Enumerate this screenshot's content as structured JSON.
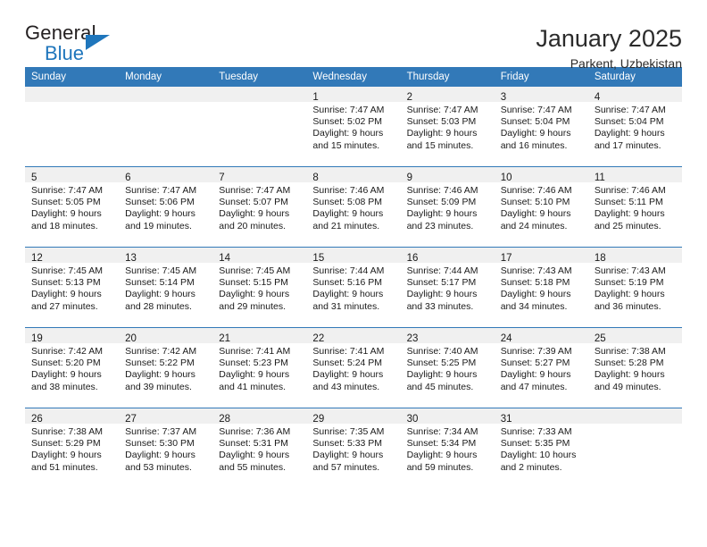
{
  "brand": {
    "name_top": "General",
    "name_bottom": "Blue",
    "triangle_icon": "brand-triangle-icon",
    "accent_color": "#1f76bc"
  },
  "header": {
    "month_title": "January 2025",
    "location": "Parkent, Uzbekistan"
  },
  "theme": {
    "header_blue": "#3279b8",
    "daynum_strip_gray": "#f0f0f0",
    "text_color": "#1a1a1a"
  },
  "calendar": {
    "weekday_headers": [
      "Sunday",
      "Monday",
      "Tuesday",
      "Wednesday",
      "Thursday",
      "Friday",
      "Saturday"
    ],
    "weeks": [
      [
        {
          "day": "",
          "lines": []
        },
        {
          "day": "",
          "lines": []
        },
        {
          "day": "",
          "lines": []
        },
        {
          "day": "1",
          "lines": [
            "Sunrise: 7:47 AM",
            "Sunset: 5:02 PM",
            "Daylight: 9 hours",
            "and 15 minutes."
          ]
        },
        {
          "day": "2",
          "lines": [
            "Sunrise: 7:47 AM",
            "Sunset: 5:03 PM",
            "Daylight: 9 hours",
            "and 15 minutes."
          ]
        },
        {
          "day": "3",
          "lines": [
            "Sunrise: 7:47 AM",
            "Sunset: 5:04 PM",
            "Daylight: 9 hours",
            "and 16 minutes."
          ]
        },
        {
          "day": "4",
          "lines": [
            "Sunrise: 7:47 AM",
            "Sunset: 5:04 PM",
            "Daylight: 9 hours",
            "and 17 minutes."
          ]
        }
      ],
      [
        {
          "day": "5",
          "lines": [
            "Sunrise: 7:47 AM",
            "Sunset: 5:05 PM",
            "Daylight: 9 hours",
            "and 18 minutes."
          ]
        },
        {
          "day": "6",
          "lines": [
            "Sunrise: 7:47 AM",
            "Sunset: 5:06 PM",
            "Daylight: 9 hours",
            "and 19 minutes."
          ]
        },
        {
          "day": "7",
          "lines": [
            "Sunrise: 7:47 AM",
            "Sunset: 5:07 PM",
            "Daylight: 9 hours",
            "and 20 minutes."
          ]
        },
        {
          "day": "8",
          "lines": [
            "Sunrise: 7:46 AM",
            "Sunset: 5:08 PM",
            "Daylight: 9 hours",
            "and 21 minutes."
          ]
        },
        {
          "day": "9",
          "lines": [
            "Sunrise: 7:46 AM",
            "Sunset: 5:09 PM",
            "Daylight: 9 hours",
            "and 23 minutes."
          ]
        },
        {
          "day": "10",
          "lines": [
            "Sunrise: 7:46 AM",
            "Sunset: 5:10 PM",
            "Daylight: 9 hours",
            "and 24 minutes."
          ]
        },
        {
          "day": "11",
          "lines": [
            "Sunrise: 7:46 AM",
            "Sunset: 5:11 PM",
            "Daylight: 9 hours",
            "and 25 minutes."
          ]
        }
      ],
      [
        {
          "day": "12",
          "lines": [
            "Sunrise: 7:45 AM",
            "Sunset: 5:13 PM",
            "Daylight: 9 hours",
            "and 27 minutes."
          ]
        },
        {
          "day": "13",
          "lines": [
            "Sunrise: 7:45 AM",
            "Sunset: 5:14 PM",
            "Daylight: 9 hours",
            "and 28 minutes."
          ]
        },
        {
          "day": "14",
          "lines": [
            "Sunrise: 7:45 AM",
            "Sunset: 5:15 PM",
            "Daylight: 9 hours",
            "and 29 minutes."
          ]
        },
        {
          "day": "15",
          "lines": [
            "Sunrise: 7:44 AM",
            "Sunset: 5:16 PM",
            "Daylight: 9 hours",
            "and 31 minutes."
          ]
        },
        {
          "day": "16",
          "lines": [
            "Sunrise: 7:44 AM",
            "Sunset: 5:17 PM",
            "Daylight: 9 hours",
            "and 33 minutes."
          ]
        },
        {
          "day": "17",
          "lines": [
            "Sunrise: 7:43 AM",
            "Sunset: 5:18 PM",
            "Daylight: 9 hours",
            "and 34 minutes."
          ]
        },
        {
          "day": "18",
          "lines": [
            "Sunrise: 7:43 AM",
            "Sunset: 5:19 PM",
            "Daylight: 9 hours",
            "and 36 minutes."
          ]
        }
      ],
      [
        {
          "day": "19",
          "lines": [
            "Sunrise: 7:42 AM",
            "Sunset: 5:20 PM",
            "Daylight: 9 hours",
            "and 38 minutes."
          ]
        },
        {
          "day": "20",
          "lines": [
            "Sunrise: 7:42 AM",
            "Sunset: 5:22 PM",
            "Daylight: 9 hours",
            "and 39 minutes."
          ]
        },
        {
          "day": "21",
          "lines": [
            "Sunrise: 7:41 AM",
            "Sunset: 5:23 PM",
            "Daylight: 9 hours",
            "and 41 minutes."
          ]
        },
        {
          "day": "22",
          "lines": [
            "Sunrise: 7:41 AM",
            "Sunset: 5:24 PM",
            "Daylight: 9 hours",
            "and 43 minutes."
          ]
        },
        {
          "day": "23",
          "lines": [
            "Sunrise: 7:40 AM",
            "Sunset: 5:25 PM",
            "Daylight: 9 hours",
            "and 45 minutes."
          ]
        },
        {
          "day": "24",
          "lines": [
            "Sunrise: 7:39 AM",
            "Sunset: 5:27 PM",
            "Daylight: 9 hours",
            "and 47 minutes."
          ]
        },
        {
          "day": "25",
          "lines": [
            "Sunrise: 7:38 AM",
            "Sunset: 5:28 PM",
            "Daylight: 9 hours",
            "and 49 minutes."
          ]
        }
      ],
      [
        {
          "day": "26",
          "lines": [
            "Sunrise: 7:38 AM",
            "Sunset: 5:29 PM",
            "Daylight: 9 hours",
            "and 51 minutes."
          ]
        },
        {
          "day": "27",
          "lines": [
            "Sunrise: 7:37 AM",
            "Sunset: 5:30 PM",
            "Daylight: 9 hours",
            "and 53 minutes."
          ]
        },
        {
          "day": "28",
          "lines": [
            "Sunrise: 7:36 AM",
            "Sunset: 5:31 PM",
            "Daylight: 9 hours",
            "and 55 minutes."
          ]
        },
        {
          "day": "29",
          "lines": [
            "Sunrise: 7:35 AM",
            "Sunset: 5:33 PM",
            "Daylight: 9 hours",
            "and 57 minutes."
          ]
        },
        {
          "day": "30",
          "lines": [
            "Sunrise: 7:34 AM",
            "Sunset: 5:34 PM",
            "Daylight: 9 hours",
            "and 59 minutes."
          ]
        },
        {
          "day": "31",
          "lines": [
            "Sunrise: 7:33 AM",
            "Sunset: 5:35 PM",
            "Daylight: 10 hours",
            "and 2 minutes."
          ]
        },
        {
          "day": "",
          "lines": []
        }
      ]
    ]
  }
}
